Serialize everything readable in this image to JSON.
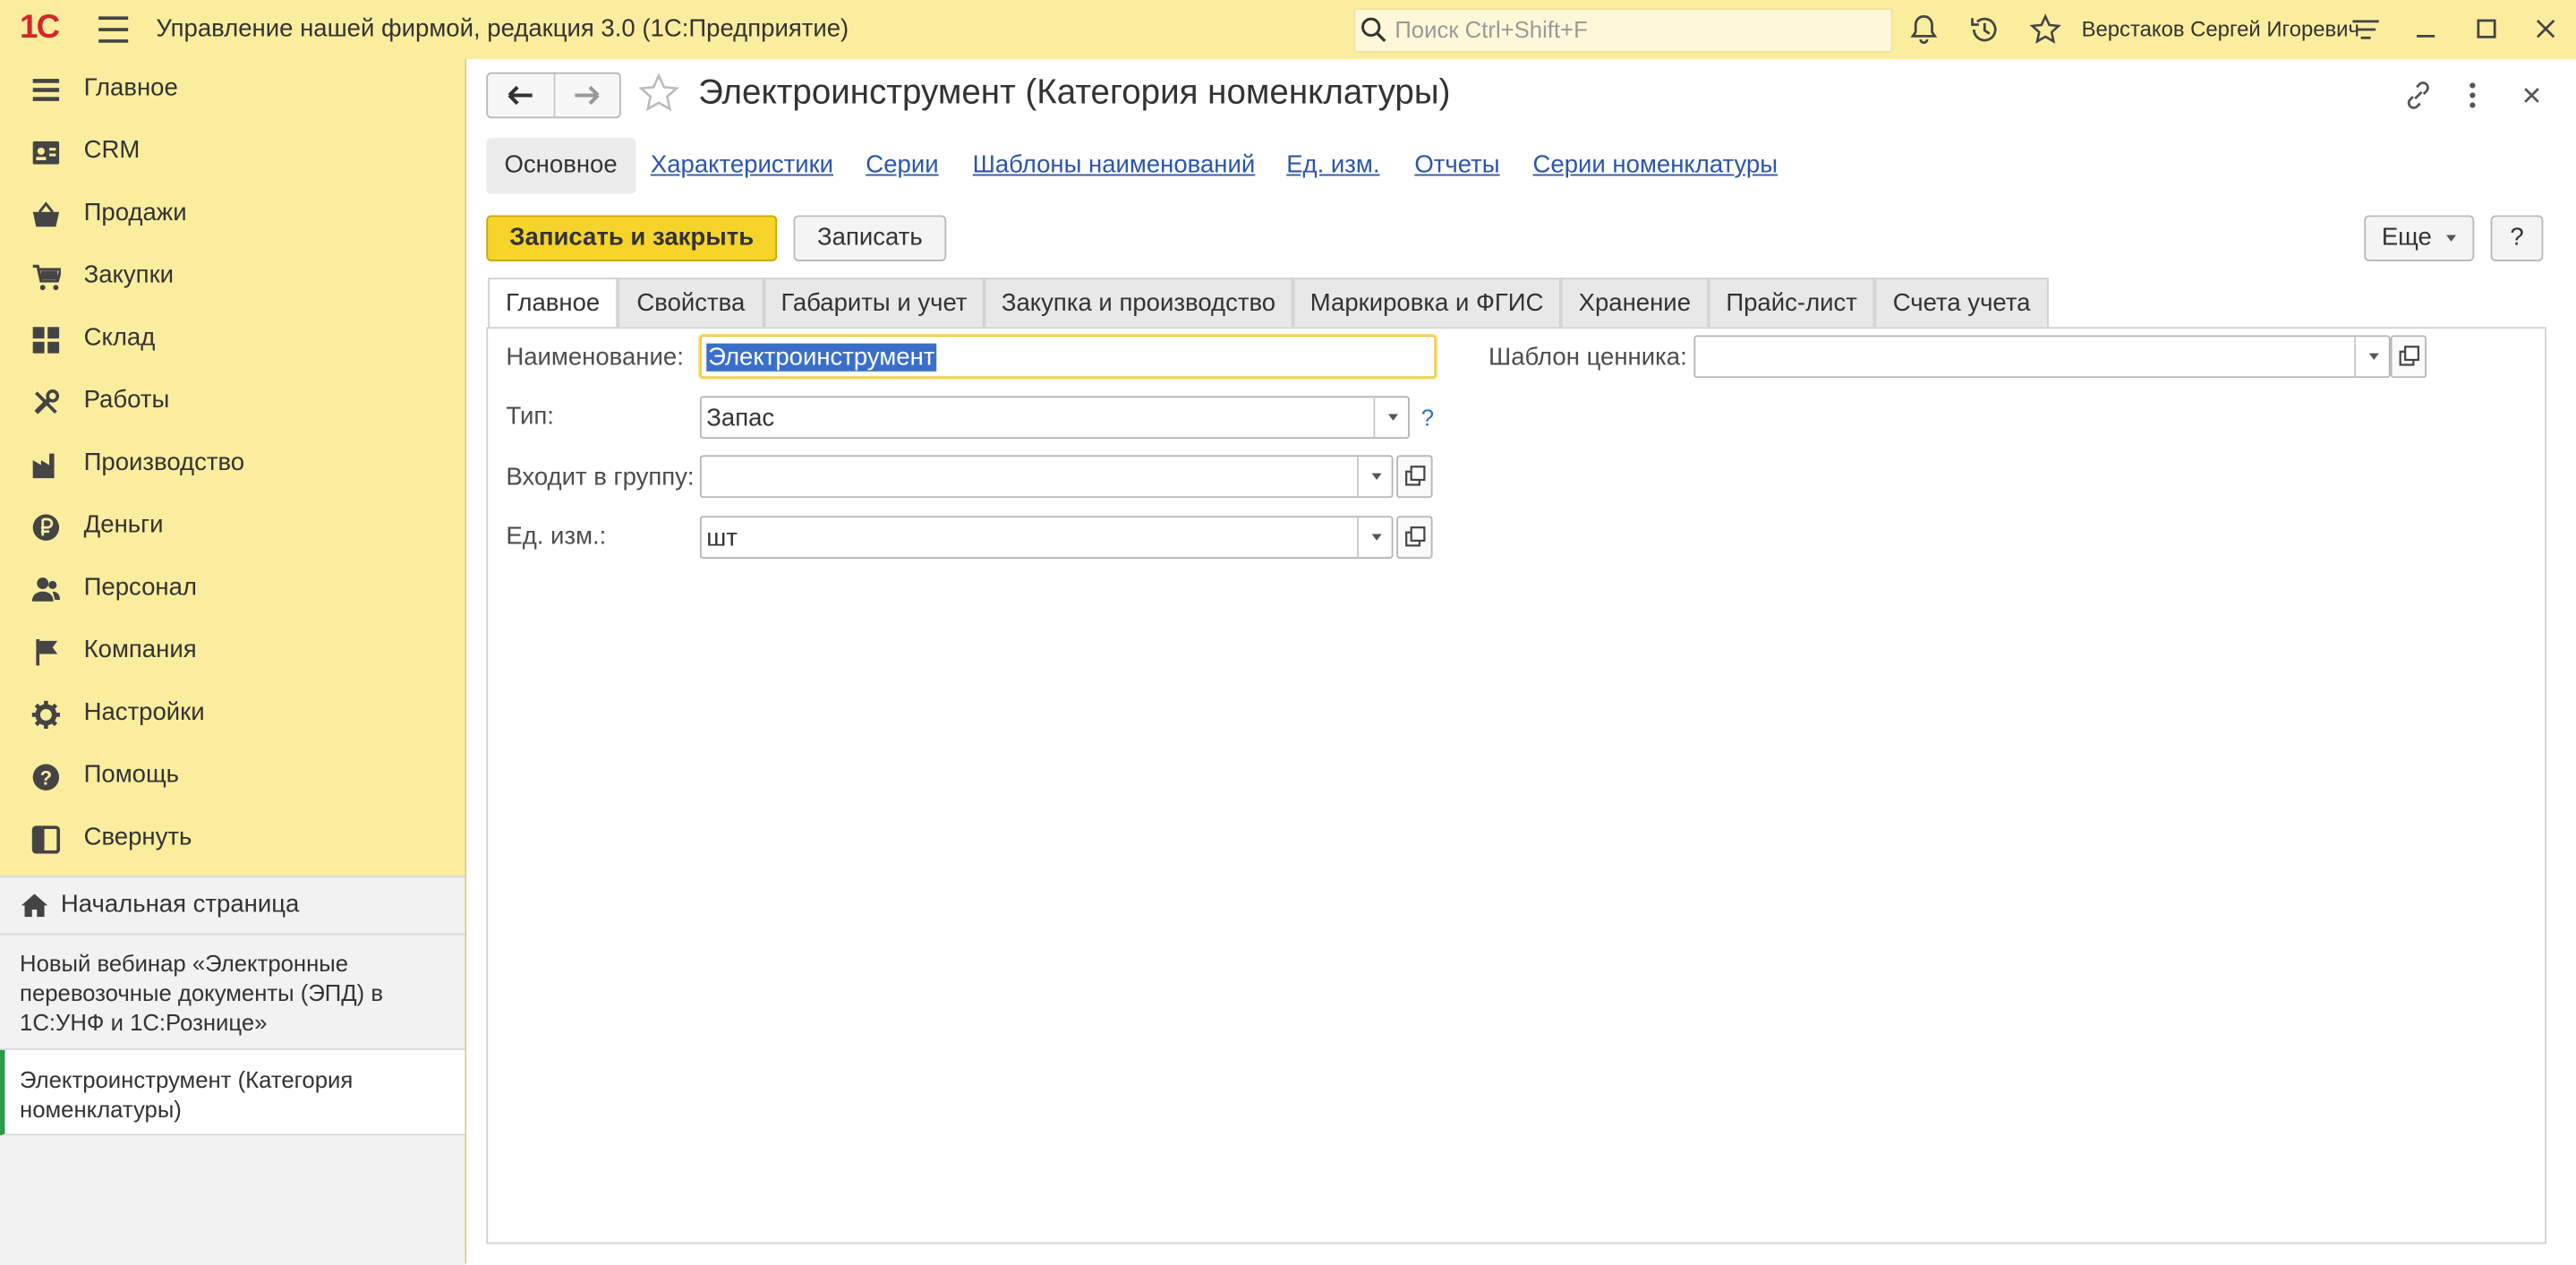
{
  "window": {
    "app_title": "Управление нашей фирмой, редакция 3.0  (1С:Предприятие)",
    "search_placeholder": "Поиск Ctrl+Shift+F",
    "user_name": "Верстаков Сергей Игоревич",
    "logo": "1С"
  },
  "sidebar": {
    "items": [
      {
        "label": "Главное",
        "icon": "menu-lines-icon"
      },
      {
        "label": "CRM",
        "icon": "contact-card-icon"
      },
      {
        "label": "Продажи",
        "icon": "basket-icon"
      },
      {
        "label": "Закупки",
        "icon": "cart-icon"
      },
      {
        "label": "Склад",
        "icon": "warehouse-grid-icon"
      },
      {
        "label": "Работы",
        "icon": "tools-icon"
      },
      {
        "label": "Производство",
        "icon": "factory-icon"
      },
      {
        "label": "Деньги",
        "icon": "ruble-coin-icon"
      },
      {
        "label": "Персонал",
        "icon": "people-icon"
      },
      {
        "label": "Компания",
        "icon": "flag-icon"
      },
      {
        "label": "Настройки",
        "icon": "gear-icon"
      },
      {
        "label": "Помощь",
        "icon": "help-circle-icon"
      },
      {
        "label": "Свернуть",
        "icon": "collapse-panel-icon"
      }
    ],
    "home": "Начальная страница",
    "open_windows": [
      "Новый вебинар «Электронные перевозочные документы (ЭПД) в 1С:УНФ и 1С:Рознице»",
      "Электроинструмент (Категория номенклатуры)"
    ]
  },
  "form": {
    "title": "Электроинструмент (Категория номенклатуры)",
    "sections": [
      "Основное",
      "Характеристики",
      "Серии",
      "Шаблоны наименований",
      "Ед. изм.",
      "Отчеты",
      "Серии номенклатуры"
    ],
    "buttons": {
      "save_close": "Записать и закрыть",
      "save": "Записать",
      "more": "Еще",
      "help": "?"
    },
    "tabs": [
      "Главное",
      "Свойства",
      "Габариты и учет",
      "Закупка и производство",
      "Маркировка и ФГИС",
      "Хранение",
      "Прайс-лист",
      "Счета учета"
    ],
    "fields": {
      "name_label": "Наименование:",
      "name_value": "Электроинструмент",
      "type_label": "Тип:",
      "type_value": "Запас",
      "type_help": "?",
      "group_label": "Входит в группу:",
      "group_value": "",
      "unit_label": "Ед. изм.:",
      "unit_value": "шт",
      "price_tag_label": "Шаблон ценника:",
      "price_tag_value": ""
    }
  },
  "colors": {
    "panel_yellow": "#fbed9e",
    "primary_button": "#f6d42a",
    "link": "#2b56a8",
    "selection": "#3a6fc9",
    "active_marker": "#2c9a4d"
  }
}
